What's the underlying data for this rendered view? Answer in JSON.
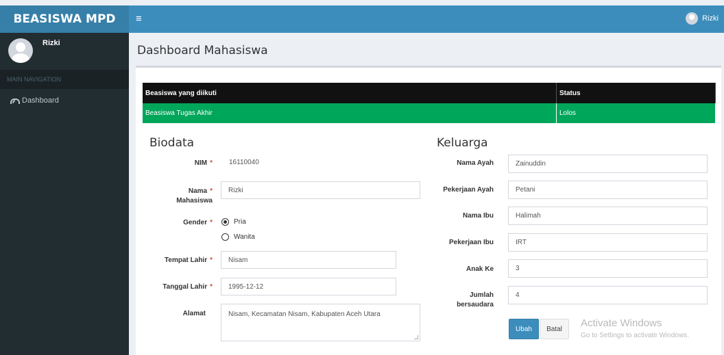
{
  "app": {
    "logo": "BEASISWA MPD",
    "menu_icon": "≡",
    "user_name": "Rizki"
  },
  "sidebar": {
    "user_name": "Rizki",
    "header": "MAIN NAVIGATION",
    "items": [
      {
        "label": "Dashboard",
        "icon": "dashboard-icon"
      }
    ]
  },
  "page": {
    "title": "Dashboard Mahasiswa"
  },
  "scholarship_table": {
    "headers": [
      "Beasiswa yang diikuti",
      "Status"
    ],
    "rows": [
      [
        "Beasiswa Tugas Akhir",
        "Lolos"
      ]
    ],
    "row_color": "#00a65a"
  },
  "biodata": {
    "title": "Biodata",
    "nim_label": "NIM",
    "nim_value": "16110040",
    "nama_label_1": "Nama",
    "nama_label_2": "Mahasiswa",
    "nama_value": "Rizki",
    "gender_label": "Gender",
    "gender_options": [
      "Pria",
      "Wanita"
    ],
    "gender_selected": "Pria",
    "tempat_label": "Tempat Lahir",
    "tempat_value": "Nisam",
    "tanggal_label": "Tanggal Lahir",
    "tanggal_value": "1995-12-12",
    "alamat_label": "Alamat",
    "alamat_value": "Nisam, Kecamatan Nisam, Kabupaten Aceh Utara",
    "required_mark": "*"
  },
  "keluarga": {
    "title": "Keluarga",
    "nama_ayah_label": "Nama Ayah",
    "nama_ayah_value": "Zainuddin",
    "pekerjaan_ayah_label": "Pekerjaan Ayah",
    "pekerjaan_ayah_value": "Petani",
    "nama_ibu_label": "Nama Ibu",
    "nama_ibu_value": "Halimah",
    "pekerjaan_ibu_label": "Pekerjaan Ibu",
    "pekerjaan_ibu_value": "IRT",
    "anak_ke_label": "Anak Ke",
    "anak_ke_value": "3",
    "jumlah_label_1": "Jumlah",
    "jumlah_label_2": "bersaudara",
    "jumlah_value": "4"
  },
  "actions": {
    "save_label": "Ubah",
    "cancel_label": "Batal"
  },
  "watermark": {
    "line1": "Activate Windows",
    "line2": "Go to Settings to activate Windows."
  },
  "colors": {
    "header": "#3c8dbc",
    "logo": "#367fa9",
    "sidebar": "#222d32",
    "success": "#00a65a",
    "required": "#dd4b39"
  }
}
